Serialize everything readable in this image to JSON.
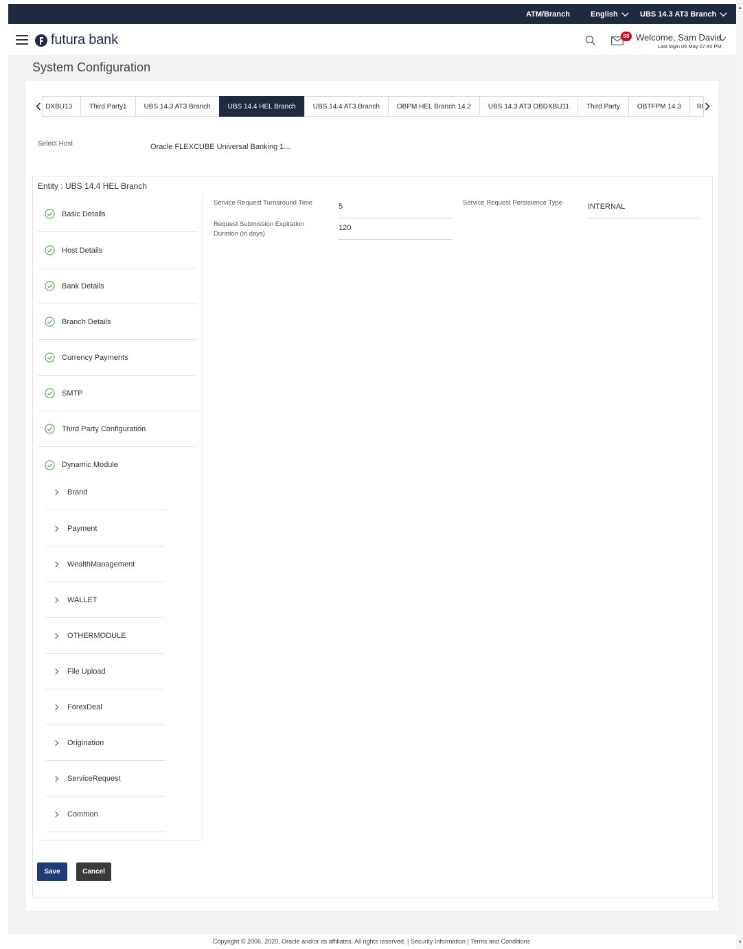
{
  "topbar": {
    "atm_branch": "ATM/Branch",
    "language": "English",
    "entity": "UBS 14.3 AT3 Branch"
  },
  "header": {
    "brand": "futura bank",
    "notification_count": "88",
    "welcome": "Welcome, Sam David",
    "last_login": "Last login 05 May 07:40 PM"
  },
  "page": {
    "title": "System Configuration"
  },
  "tabs": [
    {
      "label": "DXBU13",
      "active": false
    },
    {
      "label": "Third Party1",
      "active": false
    },
    {
      "label": "UBS 14.3 AT3 Branch",
      "active": false
    },
    {
      "label": "UBS 14.4 HEL Branch",
      "active": true
    },
    {
      "label": "UBS 14.4 AT3 Branch",
      "active": false
    },
    {
      "label": "OBPM HEL Branch 14.2",
      "active": false
    },
    {
      "label": "UBS 14.3 AT3 OBDXBU11",
      "active": false
    },
    {
      "label": "Third Party",
      "active": false
    },
    {
      "label": "OBTFPM 14.3",
      "active": false
    },
    {
      "label": "RI",
      "active": false
    }
  ],
  "host": {
    "label": "Select Host",
    "value": "Oracle FLEXCUBE Universal Banking 1..."
  },
  "entity": {
    "title": "Entity : UBS 14.4 HEL Branch"
  },
  "nav": {
    "items": [
      {
        "label": "Basic Details"
      },
      {
        "label": "Host Details"
      },
      {
        "label": "Bank Details"
      },
      {
        "label": "Branch Details"
      },
      {
        "label": "Currency Payments"
      },
      {
        "label": "SMTP"
      },
      {
        "label": "Third Party Configuration"
      },
      {
        "label": "Dynamic Module"
      }
    ],
    "sub_items": [
      {
        "label": "Brand"
      },
      {
        "label": "Payment"
      },
      {
        "label": "WealthManagement"
      },
      {
        "label": "WALLET"
      },
      {
        "label": "OTHERMODULE"
      },
      {
        "label": "File Upload"
      },
      {
        "label": "ForexDeal"
      },
      {
        "label": "Origination"
      },
      {
        "label": "ServiceRequest"
      },
      {
        "label": "Common"
      }
    ]
  },
  "fields": {
    "turnaround_label": "Service Request Turnaround Time",
    "turnaround_value": "5",
    "expiration_label_1": "Request Submission Expiration",
    "expiration_label_2": "Duration (in days)",
    "expiration_value": "120",
    "persistence_label": "Service Request Persistence Type",
    "persistence_value": "INTERNAL"
  },
  "actions": {
    "save": "Save",
    "cancel": "Cancel"
  },
  "footer": {
    "text": "Copyright © 2006, 2020, Oracle and/or its affiliates. All rights reserved. | Security Information | Terms and Conditions"
  },
  "colors": {
    "primary": "#1f2a40",
    "save_button": "#1f3c78",
    "cancel_button": "#3a3a3a",
    "badge": "#d0021b",
    "check": "#5aa05a"
  }
}
